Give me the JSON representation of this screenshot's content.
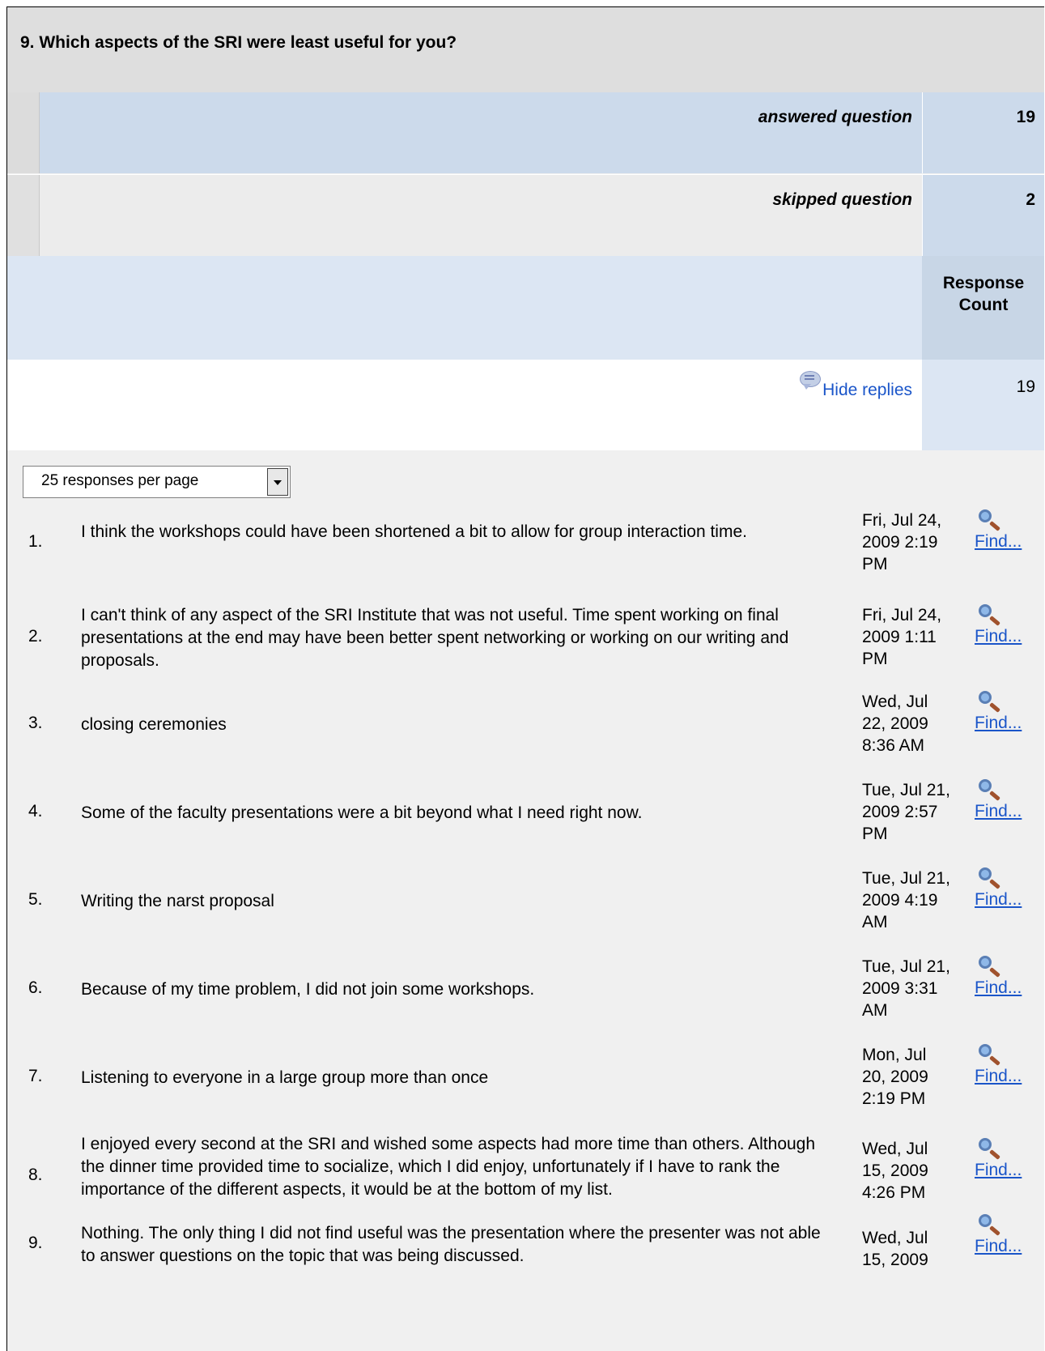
{
  "question": {
    "title": "9. Which aspects of the SRI were least useful for you?"
  },
  "summary": {
    "answered_label": "answered question",
    "answered_value": "19",
    "skipped_label": "skipped question",
    "skipped_value": "2"
  },
  "table_header": {
    "response_count": "Response Count"
  },
  "replies": {
    "hide_label": "Hide replies",
    "count": "19",
    "icon": "reply-bubble-icon"
  },
  "pager": {
    "selected": "25 responses per page"
  },
  "responses": [
    {
      "num": "1.",
      "text": "I think the workshops could have been shortened a bit to allow for group interaction time.",
      "date": "Fri, Jul 24, 2009 2:19 PM",
      "find": "Find..."
    },
    {
      "num": "2.",
      "text": "I can't think of any aspect of the SRI Institute that was not useful. Time spent working on final presentations at the end may have been better spent networking or working on our writing and proposals.",
      "date": "Fri, Jul 24, 2009 1:11 PM",
      "find": "Find..."
    },
    {
      "num": "3.",
      "text": "closing ceremonies",
      "date": "Wed, Jul 22, 2009 8:36 AM",
      "find": "Find..."
    },
    {
      "num": "4.",
      "text": "Some of the faculty presentations were a bit beyond what I need right now.",
      "date": "Tue, Jul 21, 2009 2:57 PM",
      "find": "Find..."
    },
    {
      "num": "5.",
      "text": "Writing the narst proposal",
      "date": "Tue, Jul 21, 2009 4:19 AM",
      "find": "Find..."
    },
    {
      "num": "6.",
      "text": "Because of my time problem, I did not join some workshops.",
      "date": "Tue, Jul 21, 2009 3:31 AM",
      "find": "Find..."
    },
    {
      "num": "7.",
      "text": "Listening to everyone in a large group more than once",
      "date": "Mon, Jul 20, 2009 2:19 PM",
      "find": "Find..."
    },
    {
      "num": "8.",
      "text": "I enjoyed every second at the SRI and wished some aspects had more time than others. Although the dinner time provided time to socialize, which I did enjoy, unfortunately if I have to rank the importance of the different aspects, it would be at the bottom of my list.",
      "date": "Wed, Jul 15, 2009 4:26 PM",
      "find": "Find..."
    },
    {
      "num": "9.",
      "text": "Nothing. The only thing I did not find useful was the presentation where the presenter was not able to answer questions on the topic that was being discussed.",
      "date": "Wed, Jul 15, 2009",
      "find": "Find..."
    }
  ],
  "colors": {
    "title_bg": "#dedede",
    "answered_bg": "#ccdaeb",
    "link": "#1a55c9",
    "list_bg": "#f0f0f0"
  }
}
